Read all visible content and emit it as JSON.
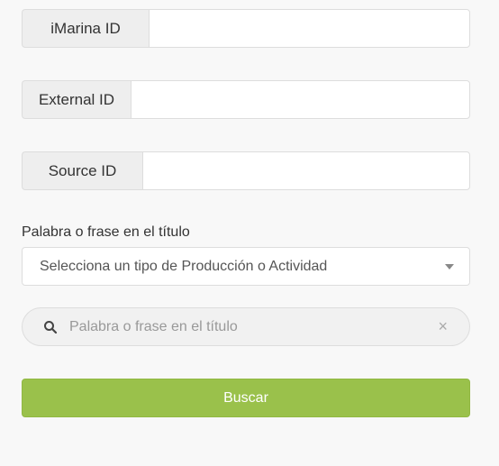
{
  "fields": {
    "imarina_id": {
      "label": "iMarina ID",
      "value": ""
    },
    "external_id": {
      "label": "External ID",
      "value": ""
    },
    "source_id": {
      "label": "Source ID",
      "value": ""
    }
  },
  "title_filter": {
    "label": "Palabra o frase en el título",
    "select_placeholder": "Selecciona un tipo de Producción o Actividad",
    "search_placeholder": "Palabra o frase en el título",
    "search_value": ""
  },
  "actions": {
    "search_button_label": "Buscar"
  },
  "colors": {
    "primary_button": "#9ac14b",
    "background": "#f8f8f8"
  }
}
